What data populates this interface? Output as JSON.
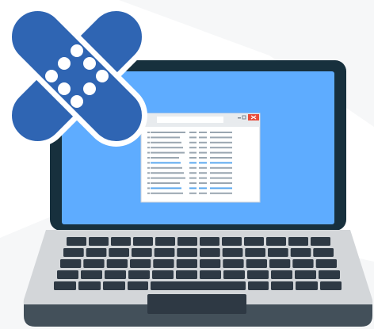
{
  "illustration": {
    "subject": "laptop-with-bandage",
    "icons": [
      "laptop-icon",
      "bandage-icon"
    ]
  },
  "colors": {
    "background": "#ffffff",
    "bg_shape": "#f6f7f8",
    "bezel": "#17303d",
    "screen": "#5eacff",
    "window_body": "#ffffff",
    "window_titlebar": "#e8ebee",
    "window_close": "#e74c3c",
    "text_line": "#9aa6b1",
    "text_line_highlight": "#5aa8ef",
    "base": "#d3d6d9",
    "base_front": "#43505a",
    "key": "#2e3944",
    "bandage": "#2f65b3",
    "bandage_outline": "#ffffff"
  }
}
